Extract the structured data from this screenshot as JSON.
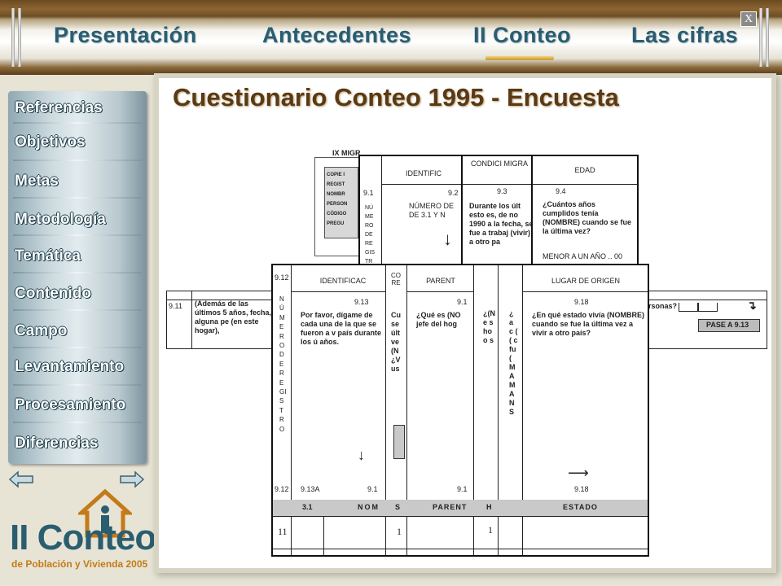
{
  "window": {
    "nav": [
      "Presentación",
      "Antecedentes",
      "II Conteo",
      "Las cifras"
    ],
    "active_nav": "II Conteo",
    "close_label": "X"
  },
  "sidebar": {
    "items": [
      "Referencias",
      "Objetivos",
      "Metas",
      "Metodología",
      "Temática",
      "Contenido",
      "Campo",
      "Levantamiento",
      "Procesamiento",
      "Diferencias"
    ]
  },
  "logo": {
    "title": "II Conteo",
    "subtitle": "de Población y Vivienda 2005"
  },
  "page": {
    "title": "Cuestionario Conteo 1995 - Encuesta"
  },
  "questionnaire": {
    "back_top": {
      "section": "IX MIGR",
      "instructions": [
        "COPIE I",
        "REGIST",
        "NOMBR",
        "PERSON",
        "CÓDIGO",
        "PREGU"
      ],
      "q91_num": "9.1",
      "q91_vertical": "NÚMERO DE REGISTRO",
      "identif": "IDENTIFIC",
      "q92_num": "9.2",
      "q92_text": "NÚMERO DE DE 3.1 Y N",
      "condici": "CONDICI MIGRA",
      "q93_num": "9.3",
      "q93_text": "Durante los últ esto es, de no 1990 a la fecha, se fue a trabaj (vivir) a otro pa",
      "edad": "EDAD",
      "q94_num": "9.4",
      "q94_text": "¿Cuántos años cumplidos tenía (NOMBRE) cuando se fue la última vez?",
      "q94_menor": "MENOR A UN AÑO .. 00"
    },
    "strip": {
      "num": "9.11",
      "text": "(Además de las últimos 5 años, fecha, alguna pe (en este hogar),",
      "tail": "ersonas?",
      "pase": "PASE A 9.13"
    },
    "front": {
      "q912": "9.12",
      "vertical": "NÚMERO DE REGISTRO",
      "identif": "IDENTIFICAC",
      "q913_num": "9.13",
      "q913_text": "Por favor, dígame de cada una de la que se fueron a v país durante los ú años.",
      "q913a": "9.13A",
      "q91x": "9.1",
      "col_co": "CO RE",
      "co_text": "Cu se últ ve (N ¿V us",
      "col_parent": "PARENT",
      "q91p": "9.1",
      "parent_text": "¿Qué es (NO jefe del hog",
      "col4_text": "¿(N e s ho o s",
      "col5_text": "¿ a c ( ( c fu ( M A M A N S",
      "origen_hdr": "LUGAR DE ORIGEN",
      "q918_num": "9.18",
      "q918_text": "¿En qué estado vivía (NOMBRE) cuando se fue la última vez a vivir a otro país?",
      "q918_bottom": "9.18",
      "tbl_31": "3.1",
      "tbl_nom": "NOM",
      "tbl_s": "S",
      "tbl_parent": "PARENT",
      "tbl_h": "H",
      "tbl_estado": "ESTADO",
      "row_11": "11",
      "row_1a": "1",
      "row_1b": "1"
    }
  },
  "colors": {
    "nav_text": "#2b5d70",
    "title_text": "#5a3a14",
    "menu_panel": "#b8c9cf",
    "background": "#e7e4d6"
  }
}
